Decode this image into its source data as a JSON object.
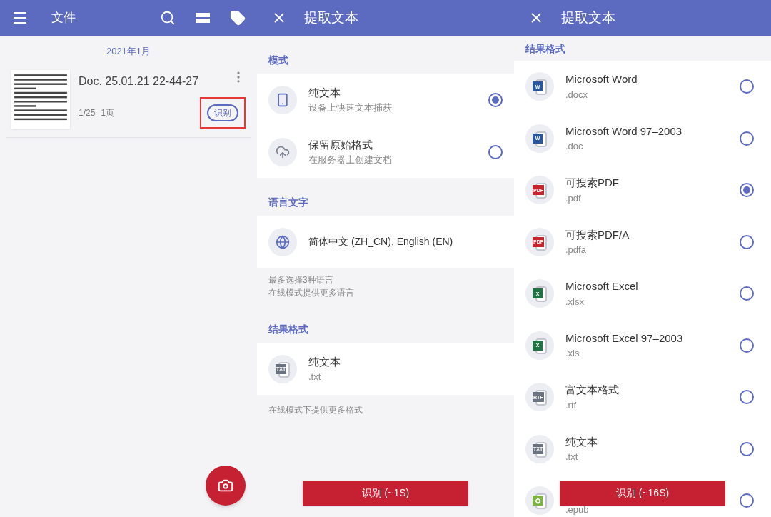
{
  "file_list_screen": {
    "title": "文件",
    "group_header": "2021年1月",
    "documents": [
      {
        "name": "Doc. 25.01.21 22-44-27",
        "page_position": "1/25",
        "page_count": "1页",
        "action": "识别",
        "highlighted": true
      }
    ]
  },
  "extract_screen": {
    "title": "提取文本",
    "mode_section": {
      "header": "模式",
      "options": [
        {
          "kind": "phone",
          "title": "纯文本",
          "subtitle": "设备上快速文本捕获",
          "selected": true
        },
        {
          "kind": "cloud",
          "title": "保留原始格式",
          "subtitle": "在服务器上创建文档",
          "selected": false
        }
      ]
    },
    "language_section": {
      "header": "语言文字",
      "value": "简体中文 (ZH_CN), English (EN)",
      "notes": [
        "最多选择3种语言",
        "在线模式提供更多语言"
      ]
    },
    "format_section": {
      "header": "结果格式",
      "title": "纯文本",
      "extension": ".txt",
      "icon_label": "TXT",
      "color": "#6b7280",
      "note": "在线模式下提供更多格式"
    },
    "action_button": "识别 (~1S)"
  },
  "format_screen": {
    "title": "提取文本",
    "header": "结果格式",
    "formats": [
      {
        "kind": "label",
        "icon_label": "W",
        "color": "#2b579a",
        "title": "Microsoft Word",
        "extension": ".docx",
        "selected": false
      },
      {
        "kind": "label",
        "icon_label": "W",
        "color": "#2b579a",
        "title": "Microsoft Word 97–2003",
        "extension": ".doc",
        "selected": false
      },
      {
        "kind": "label",
        "icon_label": "PDF",
        "color": "#c4262e",
        "title": "可搜索PDF",
        "extension": ".pdf",
        "selected": true
      },
      {
        "kind": "label",
        "icon_label": "PDF",
        "color": "#c4262e",
        "title": "可搜索PDF/A",
        "extension": ".pdfa",
        "selected": false
      },
      {
        "kind": "label",
        "icon_label": "X",
        "color": "#217346",
        "title": "Microsoft Excel",
        "extension": ".xlsx",
        "selected": false
      },
      {
        "kind": "label",
        "icon_label": "X",
        "color": "#217346",
        "title": "Microsoft Excel 97–2003",
        "extension": ".xls",
        "selected": false
      },
      {
        "kind": "label",
        "icon_label": "RTF",
        "color": "#6b7280",
        "title": "富文本格式",
        "extension": ".rtf",
        "selected": false
      },
      {
        "kind": "label",
        "icon_label": "TXT",
        "color": "#6b7280",
        "title": "纯文本",
        "extension": ".txt",
        "selected": false
      },
      {
        "kind": "symbol",
        "color": "#7cb342",
        "extension": ".epub",
        "selected": false
      }
    ],
    "action_button": "识别 (~16S)"
  }
}
